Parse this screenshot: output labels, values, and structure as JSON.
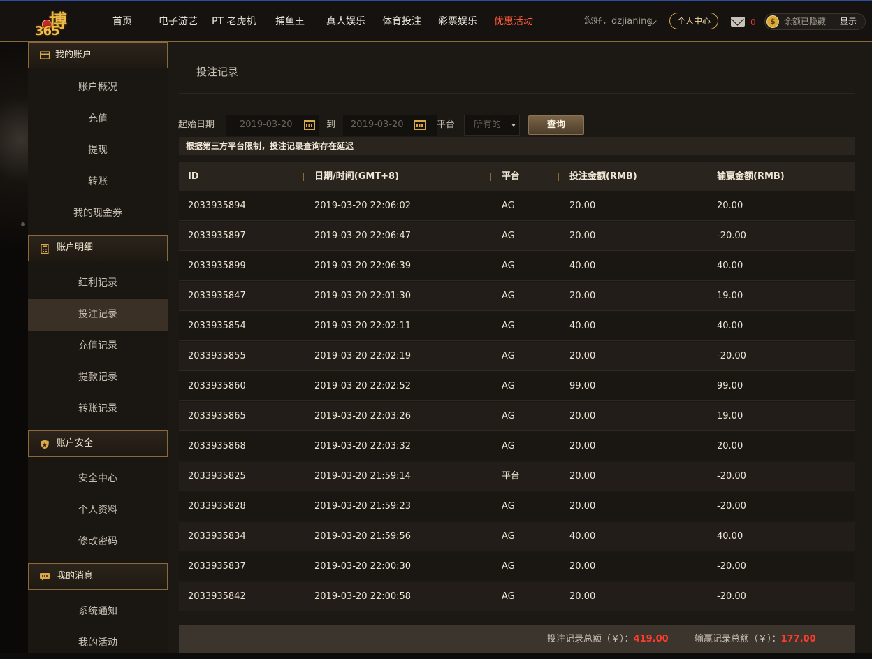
{
  "nav": {
    "logo_text_1": "博",
    "logo_text_2": "365",
    "items": [
      "首页",
      "电子游艺",
      "PT 老虎机",
      "捕鱼王",
      "真人娱乐",
      "体育投注",
      "彩票娱乐",
      "优惠活动"
    ],
    "greeting": "您好，dzjianing",
    "personal_center": "个人中心",
    "mail_count": "0",
    "balance_hidden": "余额已隐藏",
    "show_label": "显示",
    "coin_symbol": "$"
  },
  "sidebar": {
    "sections": [
      {
        "title": "我的账户",
        "items": [
          "账户概况",
          "充值",
          "提现",
          "转账",
          "我的现金券"
        ]
      },
      {
        "title": "账户明细",
        "items": [
          "红利记录",
          "投注记录",
          "充值记录",
          "提款记录",
          "转账记录"
        ]
      },
      {
        "title": "账户安全",
        "items": [
          "安全中心",
          "个人资料",
          "修改密码"
        ]
      },
      {
        "title": "我的消息",
        "items": [
          "系统通知",
          "我的活动"
        ]
      }
    ],
    "active_item": "投注记录"
  },
  "page": {
    "title": "投注记录",
    "filter": {
      "start_label": "起始日期",
      "start_date": "2019-03-20",
      "to_label": "到",
      "end_date": "2019-03-20",
      "platform_label": "平台",
      "platform_value": "所有的",
      "query_button": "查询"
    },
    "notice": "根据第三方平台限制，投注记录查询存在延迟"
  },
  "table": {
    "columns": [
      "ID",
      "日期/时间(GMT+8)",
      "平台",
      "投注金额(RMB)",
      "输赢金额(RMB)"
    ],
    "rows": [
      [
        "2033935894",
        "2019-03-20 22:06:02",
        "AG",
        "20.00",
        "20.00"
      ],
      [
        "2033935897",
        "2019-03-20 22:06:47",
        "AG",
        "20.00",
        "-20.00"
      ],
      [
        "2033935899",
        "2019-03-20 22:06:39",
        "AG",
        "40.00",
        "40.00"
      ],
      [
        "2033935847",
        "2019-03-20 22:01:30",
        "AG",
        "20.00",
        "19.00"
      ],
      [
        "2033935854",
        "2019-03-20 22:02:11",
        "AG",
        "40.00",
        "40.00"
      ],
      [
        "2033935855",
        "2019-03-20 22:02:19",
        "AG",
        "20.00",
        "-20.00"
      ],
      [
        "2033935860",
        "2019-03-20 22:02:52",
        "AG",
        "99.00",
        "99.00"
      ],
      [
        "2033935865",
        "2019-03-20 22:03:26",
        "AG",
        "20.00",
        "19.00"
      ],
      [
        "2033935868",
        "2019-03-20 22:03:32",
        "AG",
        "20.00",
        "20.00"
      ],
      [
        "2033935825",
        "2019-03-20 21:59:14",
        "平台",
        "20.00",
        "-20.00"
      ],
      [
        "2033935828",
        "2019-03-20 21:59:23",
        "AG",
        "20.00",
        "-20.00"
      ],
      [
        "2033935834",
        "2019-03-20 21:59:56",
        "AG",
        "40.00",
        "40.00"
      ],
      [
        "2033935837",
        "2019-03-20 22:00:30",
        "AG",
        "20.00",
        "-20.00"
      ],
      [
        "2033935842",
        "2019-03-20 22:00:58",
        "AG",
        "20.00",
        "-20.00"
      ]
    ]
  },
  "summary": {
    "bet_total_label": "投注记录总额（￥）：",
    "bet_total_value": "419.00",
    "win_total_label": "输赢记录总额（￥）：",
    "win_total_value": "177.00"
  },
  "colors": {
    "accent_gold": "#d8a84a",
    "promo_red": "#ff5a3a",
    "total_red": "#ff3b2a"
  }
}
